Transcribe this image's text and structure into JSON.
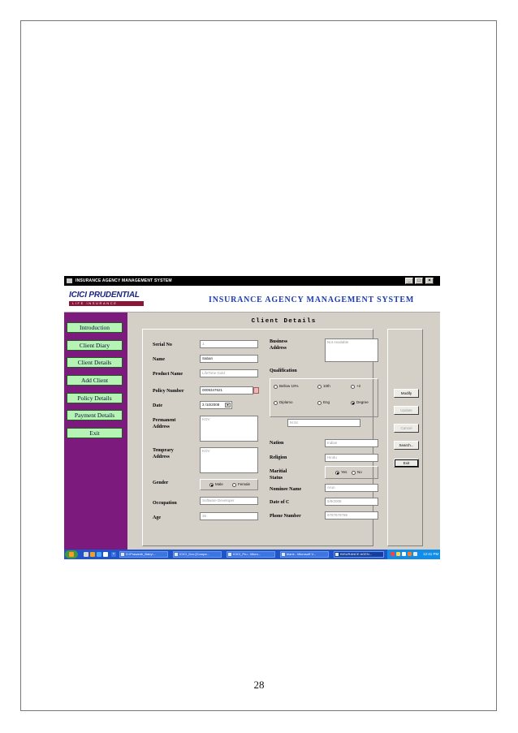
{
  "page": {
    "number": "28"
  },
  "window": {
    "title": "INSURANCE AGENCY MANAGEMENT SYSTEM"
  },
  "header": {
    "logo_main": "ICICI PRUDENTIAL",
    "logo_sub": "LIFE INSURANCE",
    "app_title": "INSURANCE AGENCY MANAGEMENT SYSTEM"
  },
  "sidebar": {
    "items": [
      {
        "label": "Introduction"
      },
      {
        "label": "Client Diary"
      },
      {
        "label": "Client Details"
      },
      {
        "label": "Add Client"
      },
      {
        "label": "Policy Details"
      },
      {
        "label": "Payment Details"
      },
      {
        "label": "Exit"
      }
    ]
  },
  "form": {
    "title": "Client Details",
    "labels": {
      "serial_no": "Serial No",
      "name": "Name",
      "product_name": "Product Name",
      "policy_number": "Policy Number",
      "date": "Date",
      "permanent_address_1": "Permanent",
      "permanent_address_2": "Address",
      "temporary_address_1": "Temprary",
      "temporary_address_2": "Address",
      "gender": "Gender",
      "occupation": "Occupation",
      "age": "Age",
      "business_address_1": "Business",
      "business_address_2": "Address",
      "qualification": "Qualification",
      "nation": "Nation",
      "religion": "Religion",
      "marital_status_1": "Maritial",
      "marital_status_2": "Status",
      "nominee_name": "Nominee Name",
      "date_of_c": "Date of C",
      "phone_number": "Phone Number"
    },
    "values": {
      "serial_no": "1",
      "name": "Sabari",
      "product_name": "LifeTime Gold",
      "policy_number": "0009347621",
      "date": "3 /10/2008",
      "permanent_address": "KOV",
      "temporary_address": "KOV",
      "occupation": "Software Developer",
      "age": "36",
      "business_address": "Not Available",
      "qualification_detail": "M.Sc",
      "nation": "Indian",
      "religion": "Hindu",
      "nominee_name": "Arun",
      "date_of_c": "5/9/2008",
      "phone_number": "9787878786"
    },
    "gender_options": {
      "male": "Male",
      "female": "Female",
      "selected": "Male"
    },
    "qualification_options": {
      "below_10": "Bellow 10%",
      "tenth": "10th",
      "plus2": "+2",
      "diploma": "Diplamo",
      "eng": "Eng",
      "degree": "Degree",
      "selected": "Degree"
    },
    "marital_options": {
      "yes": "Yes",
      "no": "No",
      "selected": "Yes"
    }
  },
  "actions": {
    "modify": "Modify",
    "update": "Update",
    "cancel": "Cancel",
    "search": "Search...",
    "exit": "Exit"
  },
  "taskbar": {
    "tasks": [
      "D:\\Prasanth_Baby\\...",
      "ICICI_Doc [Compa...",
      "ICICI_Pru - Micro...",
      "blank - Microsoft V...",
      "INSURANCE AGEN..."
    ],
    "clock": "12:41 PM"
  },
  "colors": {
    "sidebar_bg": "#7d1a7d",
    "nav_button_bg": "#b6f4b6",
    "heading_blue": "#1d3bb0",
    "taskbar": "#1f55c9"
  }
}
